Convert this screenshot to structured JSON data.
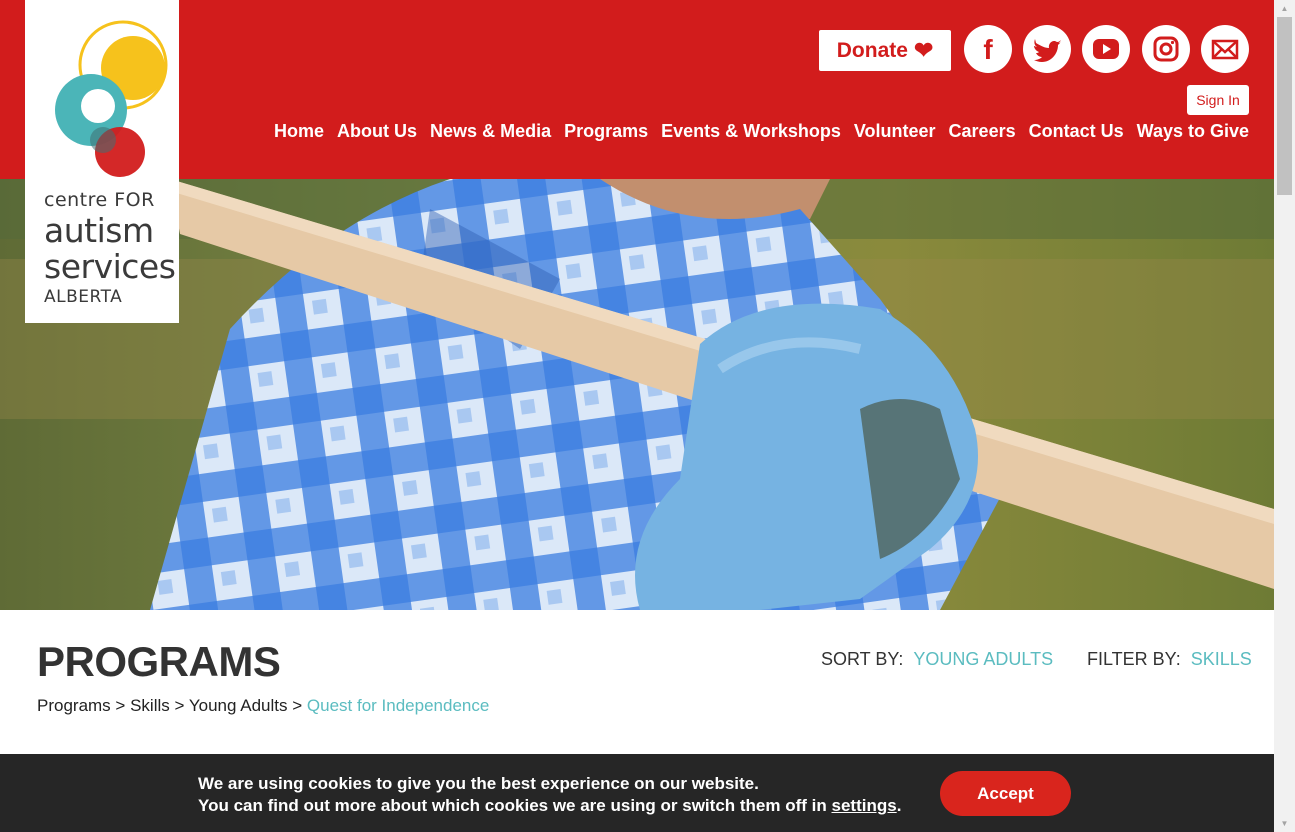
{
  "logo": {
    "line1": "centre FOR",
    "line2": "autism",
    "line3": "services",
    "line4": "ALBERTA",
    "colors": {
      "yellow": "#f6c21c",
      "teal": "#4bb5b8",
      "red": "#d21c1c"
    }
  },
  "header": {
    "donate_label": "Donate",
    "donate_icon": "heart-icon",
    "social": [
      "facebook-icon",
      "twitter-icon",
      "youtube-icon",
      "instagram-icon",
      "email-icon"
    ],
    "signin_label": "Sign In",
    "nav": [
      "Home",
      "About Us",
      "News & Media",
      "Programs",
      "Events & Workshops",
      "Volunteer",
      "Careers",
      "Contact Us",
      "Ways to Give"
    ]
  },
  "programs": {
    "title": "PROGRAMS",
    "sort_label": "SORT BY:",
    "sort_value": "YOUNG ADULTS",
    "filter_label": "FILTER BY:",
    "filter_value": "SKILLS",
    "breadcrumb": {
      "items": [
        "Programs",
        "Skills",
        "Young Adults"
      ],
      "separator": ">",
      "current": "Quest for Independence"
    }
  },
  "cookie": {
    "line1": "We are using cookies to give you the best experience on our website.",
    "line2_prefix": "You can find out more about which cookies we are using or switch them off in",
    "link": "settings",
    "line2_suffix": ".",
    "accept_label": "Accept"
  },
  "colors": {
    "brand_red": "#d21c1c",
    "accent_teal": "#5bbcc0",
    "cookie_bg": "#262626"
  }
}
